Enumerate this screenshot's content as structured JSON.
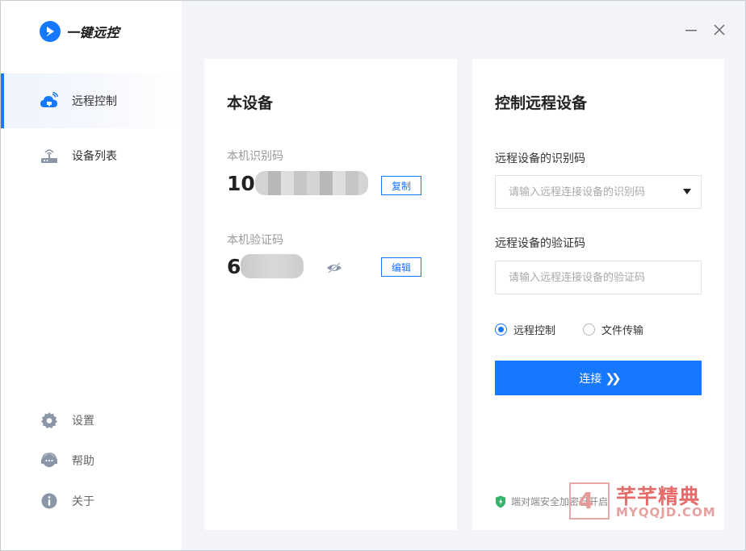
{
  "app": {
    "name": "一键远控",
    "brand_color": "#1677ff"
  },
  "sidebar": {
    "items": [
      {
        "label": "远程控制",
        "icon": "cloud-remote-icon",
        "active": true
      },
      {
        "label": "设备列表",
        "icon": "router-icon",
        "active": false
      }
    ],
    "bottom": [
      {
        "label": "设置",
        "icon": "gear-icon"
      },
      {
        "label": "帮助",
        "icon": "help-headset-icon"
      },
      {
        "label": "关于",
        "icon": "info-icon"
      }
    ]
  },
  "window": {
    "minimize": "minimize-icon",
    "close": "close-icon"
  },
  "this_device": {
    "title": "本设备",
    "id_label": "本机识别码",
    "id_value_visible": "10",
    "copy_label": "复制",
    "code_label": "本机验证码",
    "code_value_visible": "6",
    "edit_label": "编辑"
  },
  "remote": {
    "title": "控制远程设备",
    "id_label": "远程设备的识别码",
    "id_placeholder": "请输入远程连接设备的识别码",
    "code_label": "远程设备的验证码",
    "code_placeholder": "请输入远程连接设备的验证码",
    "mode_options": [
      {
        "label": "远程控制",
        "checked": true
      },
      {
        "label": "文件传输",
        "checked": false
      }
    ],
    "connect_label": "连接",
    "secure_text": "端对端安全加密已开启"
  },
  "watermark": {
    "title": "芊芊精典",
    "subtitle": "MYQQJD.COM"
  }
}
